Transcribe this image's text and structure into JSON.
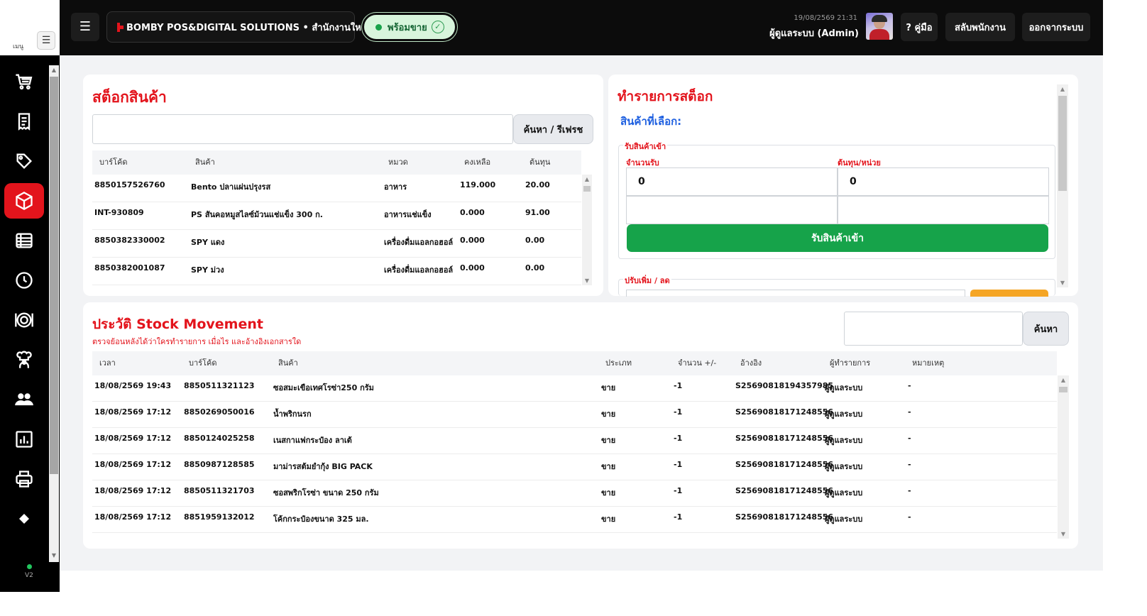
{
  "rail": {
    "menu_label": "เมนู",
    "version": "V2",
    "items": [
      {
        "icon": "shopping-cart-icon",
        "active": false
      },
      {
        "icon": "receipt-icon",
        "active": false
      },
      {
        "icon": "tag-icon",
        "active": false
      },
      {
        "icon": "box-icon",
        "active": true
      },
      {
        "icon": "table-list-icon",
        "active": false
      },
      {
        "icon": "clock-icon",
        "active": false
      },
      {
        "icon": "dish-icon",
        "active": false
      },
      {
        "icon": "chef-icon",
        "active": false
      },
      {
        "icon": "users-icon",
        "active": false
      },
      {
        "icon": "chart-icon",
        "active": false
      },
      {
        "icon": "printer-icon",
        "active": false
      },
      {
        "icon": "diamond-icon",
        "active": false
      }
    ]
  },
  "header": {
    "store_name": "BOMBY POS&DIGITAL SOLUTIONS • สำนักงานใหญ่",
    "status": "พร้อมขาย",
    "datetime": "19/08/2569 21:31",
    "user": "ผู้ดูแลระบบ (Admin)",
    "manual_label": "? คู่มือ",
    "switch_label": "สลับพนักงาน",
    "logout_label": "ออกจากระบบ",
    "colors": {
      "accent": "#e3141c",
      "ready_bg": "#d8f5dc",
      "ready_text": "#166534"
    }
  },
  "stock": {
    "title": "สต็อกสินค้า",
    "search_value": "",
    "search_button": "ค้นหา / รีเฟรช",
    "columns": [
      "บาร์โค้ด",
      "สินค้า",
      "หมวด",
      "คงเหลือ",
      "ต้นทุน"
    ],
    "rows": [
      {
        "barcode": "8850157526760",
        "name": "Bento ปลาแผ่นปรุงรส",
        "category": "อาหาร",
        "remain": "119.000",
        "cost": "20.00"
      },
      {
        "barcode": "INT-930809",
        "name": "PS สันคอหมูสไลซ์ม้วนแช่แข็ง 300 ก.",
        "category": "อาหารแช่แข็ง",
        "remain": "0.000",
        "cost": "91.00"
      },
      {
        "barcode": "8850382330002",
        "name": "SPY แดง",
        "category": "เครื่องดื่มแอลกอฮอล์",
        "remain": "0.000",
        "cost": "0.00"
      },
      {
        "barcode": "8850382001087",
        "name": "SPY ม่วง",
        "category": "เครื่องดื่มแอลกอฮอล์",
        "remain": "0.000",
        "cost": "0.00"
      }
    ]
  },
  "transaction": {
    "title": "ทำรายการสต็อก",
    "selected_label": "สินค้าที่เลือก:",
    "receive_legend": "รับสินค้าเข้า",
    "qty_label": "จำนวนรับ",
    "qty_value": "0",
    "cost_label": "ต้นทุน/หน่วย",
    "cost_value": "0",
    "receive_button": "รับสินค้าเข้า",
    "adjust_legend": "ปรับเพิ่ม / ลด"
  },
  "history": {
    "title": "ประวัติ Stock Movement",
    "subtitle": "ตรวจย้อนหลังได้ว่าใครทำรายการ เมื่อไร และอ้างอิงเอกสารใด",
    "search_value": "",
    "search_button": "ค้นหา",
    "columns": [
      "เวลา",
      "บาร์โค้ด",
      "สินค้า",
      "ประเภท",
      "จำนวน +/-",
      "อ้างอิง",
      "ผู้ทำรายการ",
      "หมายเหตุ"
    ],
    "rows": [
      {
        "time": "18/08/2569 19:43",
        "barcode": "8850511321123",
        "product": "ซอสมะเขือเทศโรซ่า250 กรัม",
        "type": "ขาย",
        "qty": "-1",
        "ref": "S25690818194357985",
        "user": "ผู้ดูแลระบบ",
        "note": "-"
      },
      {
        "time": "18/08/2569 17:12",
        "barcode": "8850269050016",
        "product": "น้ำพริกนรก",
        "type": "ขาย",
        "qty": "-1",
        "ref": "S25690818171248556",
        "user": "ผู้ดูแลระบบ",
        "note": "-"
      },
      {
        "time": "18/08/2569 17:12",
        "barcode": "8850124025258",
        "product": "เนสกาแฟกระป๋อง ลาเต้",
        "type": "ขาย",
        "qty": "-1",
        "ref": "S25690818171248556",
        "user": "ผู้ดูแลระบบ",
        "note": "-"
      },
      {
        "time": "18/08/2569 17:12",
        "barcode": "8850987128585",
        "product": "มาม่ารสต้มยำกุ้ง BIG PACK",
        "type": "ขาย",
        "qty": "-1",
        "ref": "S25690818171248556",
        "user": "ผู้ดูแลระบบ",
        "note": "-"
      },
      {
        "time": "18/08/2569 17:12",
        "barcode": "8850511321703",
        "product": "ซอสพริกโรซ่า ขนาด 250 กรัม",
        "type": "ขาย",
        "qty": "-1",
        "ref": "S25690818171248556",
        "user": "ผู้ดูแลระบบ",
        "note": "-"
      },
      {
        "time": "18/08/2569 17:12",
        "barcode": "8851959132012",
        "product": "โค้กกระป๋องขนาด 325 มล.",
        "type": "ขาย",
        "qty": "-1",
        "ref": "S25690818171248556",
        "user": "ผู้ดูแลระบบ",
        "note": "-"
      }
    ]
  }
}
